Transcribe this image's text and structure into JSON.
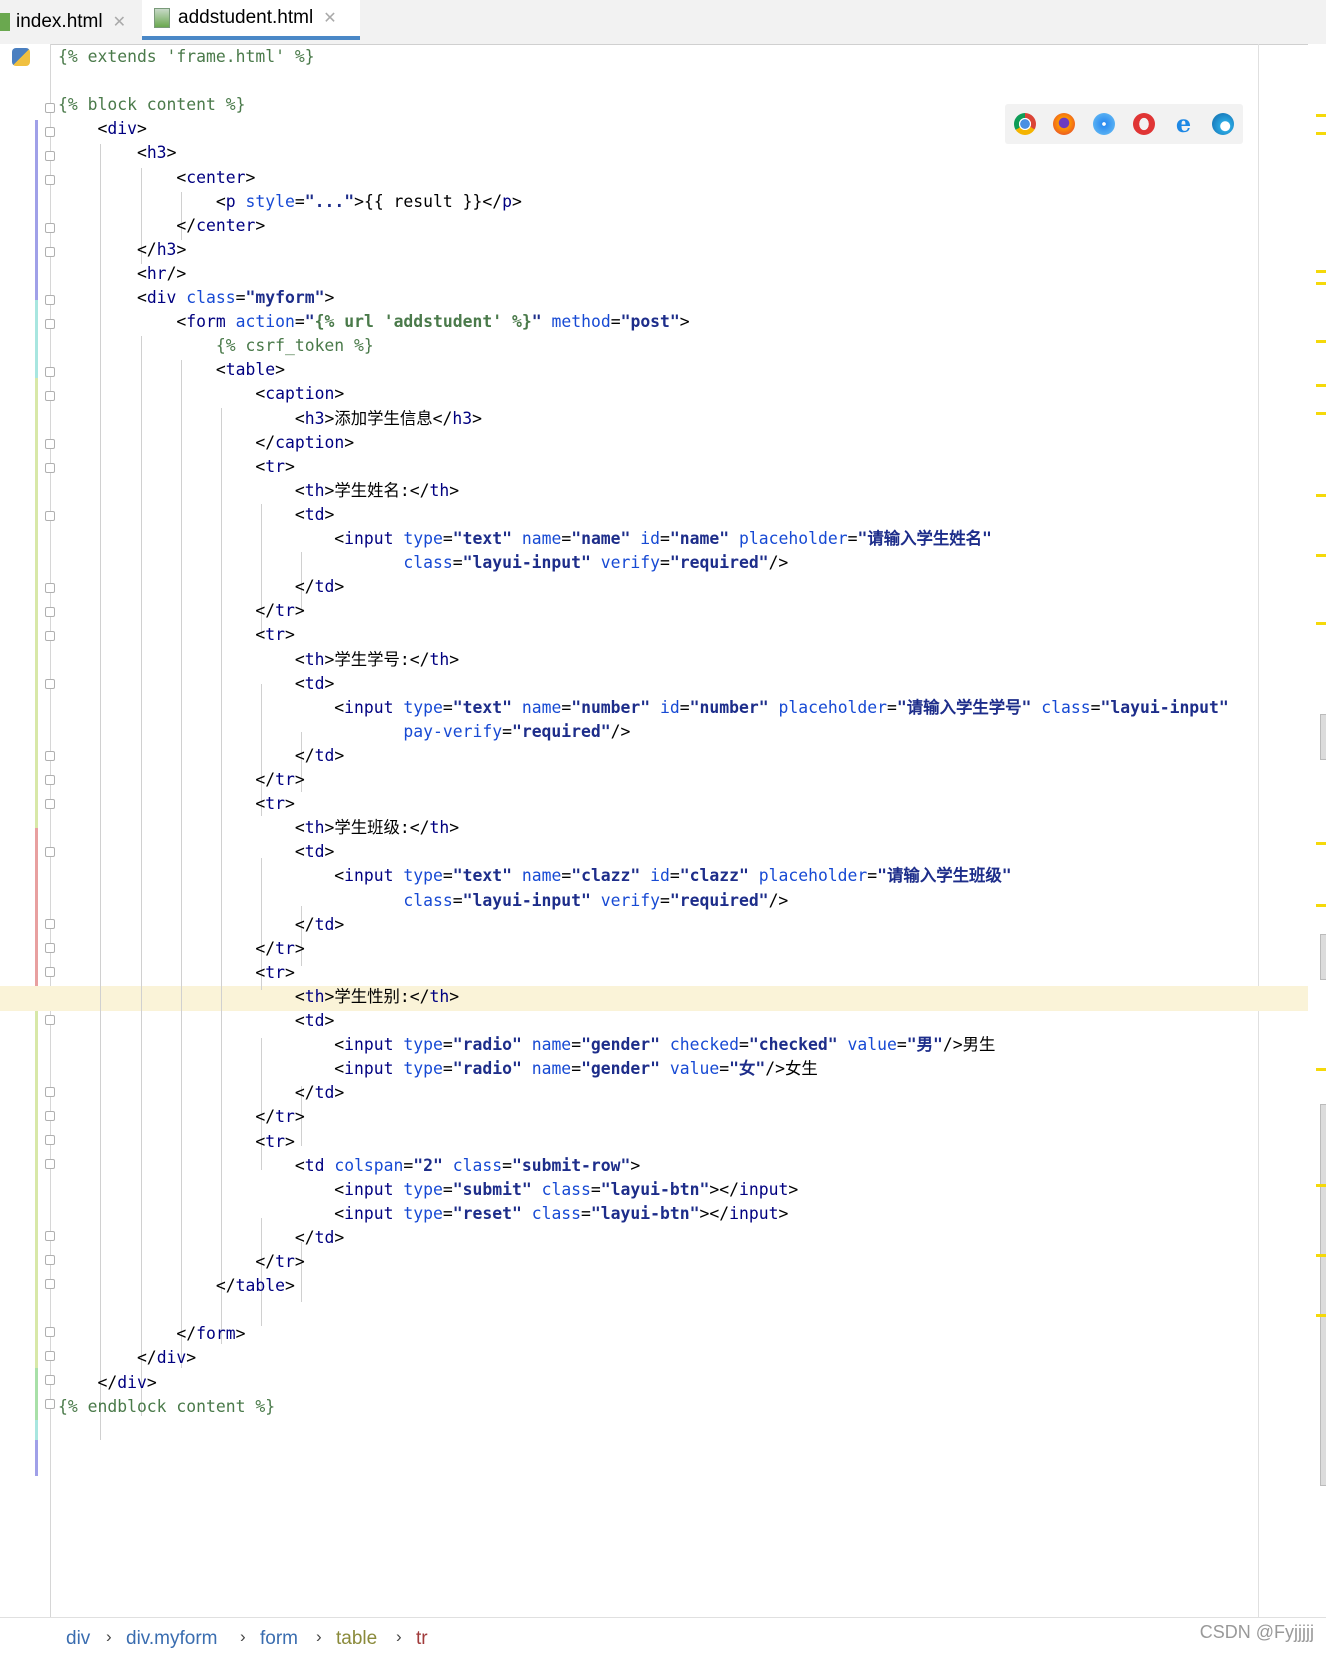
{
  "tabs": [
    {
      "label": "index.html"
    },
    {
      "label": "addstudent.html"
    }
  ],
  "code_lines": [
    "{% extends 'frame.html' %}",
    "",
    "{% block content %}",
    "    <div>",
    "        <h3>",
    "            <center>",
    "                <p style=\"...\">{{ result }}</p>",
    "            </center>",
    "        </h3>",
    "        <hr/>",
    "        <div class=\"myform\">",
    "            <form action=\"{% url 'addstudent' %}\" method=\"post\">",
    "                {% csrf_token %}",
    "                <table>",
    "                    <caption>",
    "                        <h3>添加学生信息</h3>",
    "                    </caption>",
    "                    <tr>",
    "                        <th>学生姓名:</th>",
    "                        <td>",
    "                            <input type=\"text\" name=\"name\" id=\"name\" placeholder=\"请输入学生姓名\"",
    "                                   class=\"layui-input\" verify=\"required\"/>",
    "                        </td>",
    "                    </tr>",
    "                    <tr>",
    "                        <th>学生学号:</th>",
    "                        <td>",
    "                            <input type=\"text\" name=\"number\" id=\"number\" placeholder=\"请输入学生学号\" class=\"layui-input\"",
    "                                   pay-verify=\"required\"/>",
    "                        </td>",
    "                    </tr>",
    "                    <tr>",
    "                        <th>学生班级:</th>",
    "                        <td>",
    "                            <input type=\"text\" name=\"clazz\" id=\"clazz\" placeholder=\"请输入学生班级\"",
    "                                   class=\"layui-input\" verify=\"required\"/>",
    "                        </td>",
    "                    </tr>",
    "                    <tr>",
    "                        <th>学生性别:</th>",
    "                        <td>",
    "                            <input type=\"radio\" name=\"gender\" checked=\"checked\" value=\"男\"/>男生",
    "                            <input type=\"radio\" name=\"gender\" value=\"女\"/>女生",
    "                        </td>",
    "                    </tr>",
    "                    <tr>",
    "                        <td colspan=\"2\" class=\"submit-row\">",
    "                            <input type=\"submit\" class=\"layui-btn\"></input>",
    "                            <input type=\"reset\" class=\"layui-btn\"></input>",
    "                        </td>",
    "                    </tr>",
    "                </table>",
    "",
    "            </form>",
    "        </div>",
    "    </div>",
    "{% endblock content %}"
  ],
  "browser_icons": [
    "chrome-icon",
    "firefox-icon",
    "safari-icon",
    "opera-icon",
    "ie-icon",
    "edge-icon"
  ],
  "breadcrumb": [
    "div",
    "div.myform",
    "form",
    "table",
    "tr"
  ],
  "watermark": "CSDN @Fyjjjjj",
  "colors": {
    "tag": "#000080",
    "attr_name": "#174ad4",
    "attr_value": "#067d17",
    "template": "#4a7a4a",
    "current_line": "#faf3d8",
    "breadcrumb": "#3a6db0"
  }
}
